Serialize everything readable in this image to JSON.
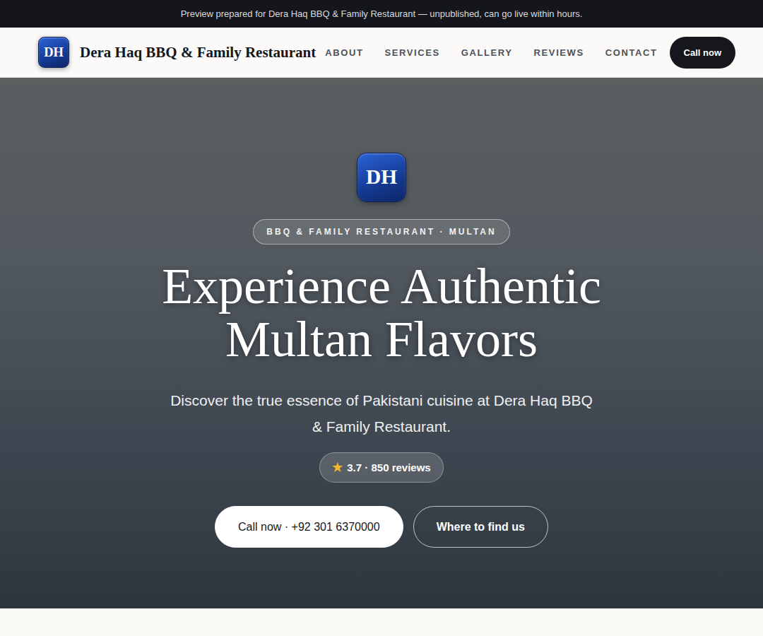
{
  "banner": {
    "text": "Preview prepared for Dera Haq BBQ & Family Restaurant — unpublished, can go live within hours."
  },
  "brand": {
    "initials": "DH",
    "name": "Dera Haq BBQ & Family Restaurant"
  },
  "nav": {
    "items": [
      {
        "label": "ABOUT"
      },
      {
        "label": "SERVICES"
      },
      {
        "label": "GALLERY"
      },
      {
        "label": "REVIEWS"
      },
      {
        "label": "CONTACT"
      }
    ],
    "button": "Call now"
  },
  "hero": {
    "initials": "DH",
    "badge": "BBQ & FAMILY RESTAURANT · MULTAN",
    "title": "Experience Authentic Multan Flavors",
    "subtitle": "Discover the true essence of Pakistani cuisine at Dera Haq BBQ & Family Restaurant.",
    "rating": {
      "star": "★",
      "text": "3.7 · 850 reviews"
    },
    "buttons": [
      {
        "label": "Call now · +92 301 6370000",
        "kind": "primary"
      },
      {
        "label": "Where to find us",
        "kind": "outline"
      }
    ]
  }
}
